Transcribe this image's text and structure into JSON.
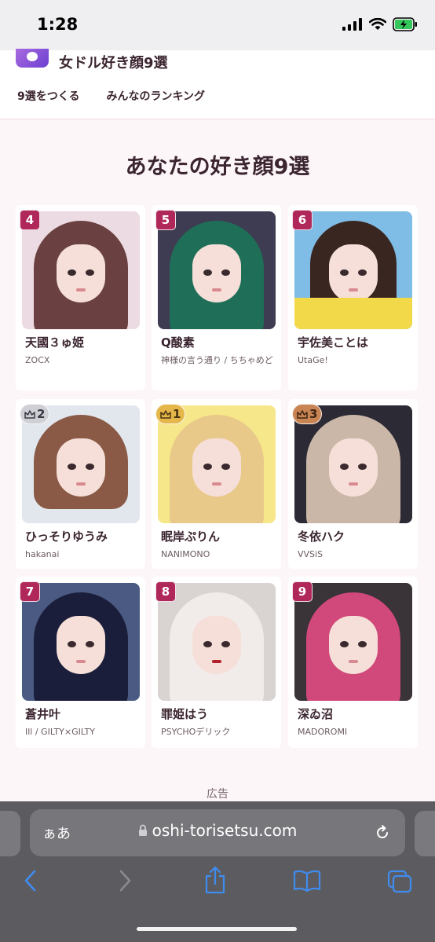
{
  "status": {
    "time": "1:28"
  },
  "header": {
    "site_title": "女ドル好き顔9選",
    "nav": [
      "9選をつくる",
      "みんなのランキング"
    ]
  },
  "page_title": "あなたの好き顔9選",
  "cards": [
    {
      "rank": "4",
      "rank_style": "number",
      "name": "天國３ゅ姫",
      "group": "ZOCX"
    },
    {
      "rank": "5",
      "rank_style": "number",
      "name": "Q酸素",
      "group": "神様の言う通り / ちちゃめど"
    },
    {
      "rank": "6",
      "rank_style": "number",
      "name": "宇佐美ことは",
      "group": "UtaGe!"
    },
    {
      "rank": "2",
      "rank_style": "silver",
      "name": "ひっそりゆうみ",
      "group": "hakanai"
    },
    {
      "rank": "1",
      "rank_style": "gold",
      "name": "眠岸ぷりん",
      "group": "NANIMONO"
    },
    {
      "rank": "3",
      "rank_style": "bronze",
      "name": "冬依ハク",
      "group": "VVSiS"
    },
    {
      "rank": "7",
      "rank_style": "number",
      "name": "蒼井叶",
      "group": "Ill / GILTY×GILTY"
    },
    {
      "rank": "8",
      "rank_style": "number",
      "name": "罪姫はう",
      "group": "PSYCHOデリック"
    },
    {
      "rank": "9",
      "rank_style": "number",
      "name": "深ゐ沼",
      "group": "MADOROMI"
    }
  ],
  "ad_label": "広告",
  "browser": {
    "aa_label": "ぁあ",
    "url": "oshi-torisetsu.com"
  },
  "colors": {
    "accent": "#b0285a",
    "background": "#fdf6f8",
    "text": "#3b2530",
    "ios_blue": "#3f8cf0"
  }
}
